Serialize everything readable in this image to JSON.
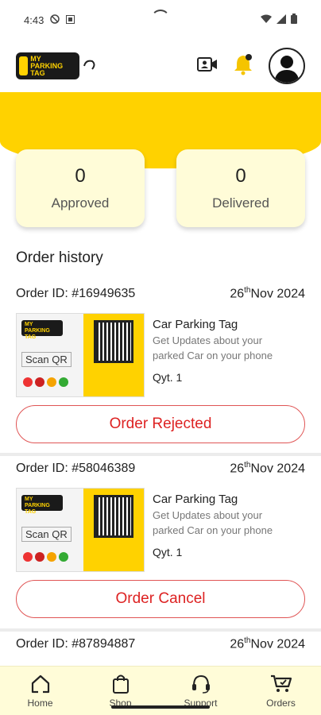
{
  "status_bar": {
    "time": "4:43"
  },
  "header": {
    "logo_line1": "MY",
    "logo_line2": "PARKING TAG"
  },
  "stats": [
    {
      "value": "0",
      "label": "Approved"
    },
    {
      "value": "0",
      "label": "Delivered"
    }
  ],
  "section_title": "Order history",
  "orders": [
    {
      "id": "Order ID: #16949635",
      "day": "26",
      "suffix": "th",
      "month_year": "Nov 2024",
      "product_title": "Car Parking Tag",
      "product_desc": "Get Updates about your parked Car on your phone",
      "qty": "Qyt. 1",
      "status": "Order Rejected",
      "img_scan": "Scan QR"
    },
    {
      "id": "Order ID: #58046389",
      "day": "26",
      "suffix": "th",
      "month_year": "Nov 2024",
      "product_title": "Car Parking Tag",
      "product_desc": "Get Updates about your parked Car on your phone",
      "qty": "Qyt. 1",
      "status": "Order Cancel",
      "img_scan": "Scan QR"
    },
    {
      "id": "Order ID: #87894887",
      "day": "26",
      "suffix": "th",
      "month_year": "Nov 2024"
    }
  ],
  "bottom_nav": [
    {
      "label": "Home",
      "icon": "home-icon"
    },
    {
      "label": "Shop",
      "icon": "shopping-bag-icon"
    },
    {
      "label": "Support",
      "icon": "headset-icon"
    },
    {
      "label": "Orders",
      "icon": "cart-icon"
    }
  ],
  "colors": {
    "accent": "#FFD200",
    "card": "#FFFCD8",
    "danger": "#DD2222"
  }
}
